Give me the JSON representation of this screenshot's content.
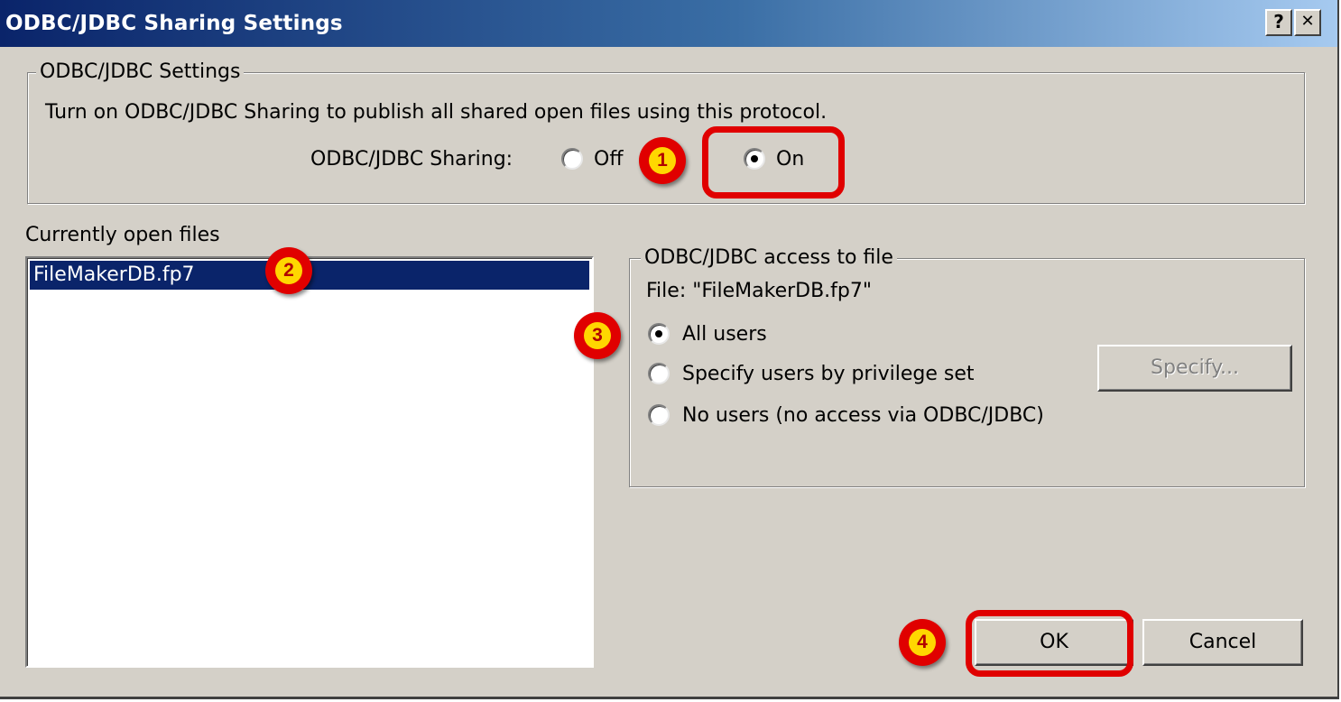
{
  "window": {
    "title": "ODBC/JDBC Sharing Settings",
    "help_glyph": "?",
    "close_glyph": "✕"
  },
  "settings_group": {
    "legend": "ODBC/JDBC Settings",
    "description": "Turn on ODBC/JDBC Sharing to publish all shared open files using this protocol.",
    "sharing_label": "ODBC/JDBC Sharing:",
    "options": [
      {
        "label": "Off",
        "checked": false
      },
      {
        "label": "On",
        "checked": true
      }
    ]
  },
  "files": {
    "label": "Currently open files",
    "items": [
      "FileMakerDB.fp7"
    ],
    "selected_index": 0
  },
  "access_group": {
    "legend": "ODBC/JDBC access to file",
    "file_line": "File: \"FileMakerDB.fp7\"",
    "options": [
      {
        "label": "All users",
        "checked": true
      },
      {
        "label": "Specify users by privilege set",
        "checked": false
      },
      {
        "label": "No users (no access via ODBC/JDBC)",
        "checked": false
      }
    ],
    "specify_button": "Specify...",
    "specify_enabled": false
  },
  "buttons": {
    "ok": "OK",
    "cancel": "Cancel"
  },
  "annotations": {
    "markers": [
      "1",
      "2",
      "3",
      "4"
    ],
    "color": "#e00000",
    "badge_fill": "#ffd700"
  }
}
